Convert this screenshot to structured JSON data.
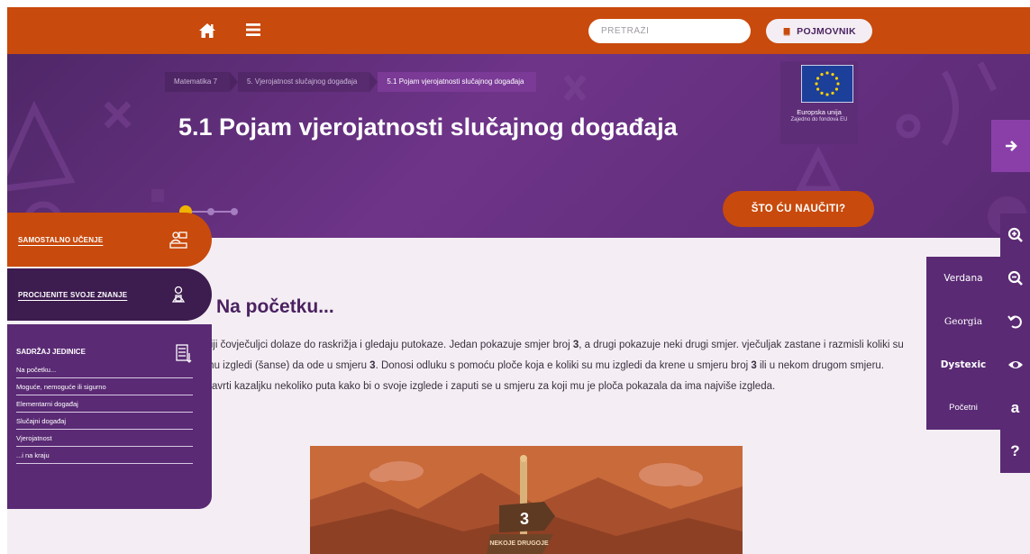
{
  "topbar": {
    "search_placeholder": "PRETRAŽI",
    "glossary_label": "POJMOVNIK",
    "icons": [
      "home-icon",
      "menu-icon",
      "book-icon"
    ]
  },
  "breadcrumb": [
    "Matematika 7",
    "5. Vjerojatnost slučajnog događaja",
    "5.1 Pojam vjerojatnosti slučajnog događaja"
  ],
  "page_title": "5.1 Pojam vjerojatnosti slučajnog događaja",
  "eu": {
    "line1": "Europska unija",
    "line2": "Zajedno do fondova EU"
  },
  "learn_button": "ŠTO ĆU NAUČITI?",
  "side": {
    "self_learning": "SAMOSTALNO UČENJE",
    "assess": "PROCIJENITE SVOJE ZNANJE",
    "contents_title": "SADRŽAJ JEDINICE",
    "contents": [
      "Na početku...",
      "Moguće, nemoguće ili sigurno",
      "Elementarni događaj",
      "Slučajni događaj",
      "Vjerojatnost",
      "...i na kraju"
    ]
  },
  "section": {
    "heading": "Na početku...",
    "paragraph_html": "ciji čovječuljci dolaze do raskrižja i gledaju putokaze. Jedan pokazuje smjer broj <b>3</b>, a drugi pokazuje neki drugi smjer. vječuljak zastane i razmisli koliki su mu izgledi (šanse) da ode u smjeru <b>3</b>. Donosi odluku s pomoću ploče koja e koliki su mu izgledi da krene u smjeru broj <b>3</b> ili u nekom drugom smjeru. Zavrti kazaljku nekoliko puta kako bi o svoje izglede i zaputi se u smjeru za koji mu je ploča pokazala da ima najviše izgleda.",
    "sign_number": "3",
    "sign_text": "NEKOJE DRUGOJE"
  },
  "fonts": [
    "Verdana",
    "Georgia",
    "Dystexic",
    "Početni"
  ],
  "tools": [
    "zoom-in-icon",
    "zoom-out-icon",
    "reset-icon",
    "eye-icon",
    "a",
    "?"
  ],
  "colors": {
    "orange": "#c84a0c",
    "purple": "#5a2a74",
    "dark_purple": "#3d1c50",
    "heading": "#4b2260"
  }
}
